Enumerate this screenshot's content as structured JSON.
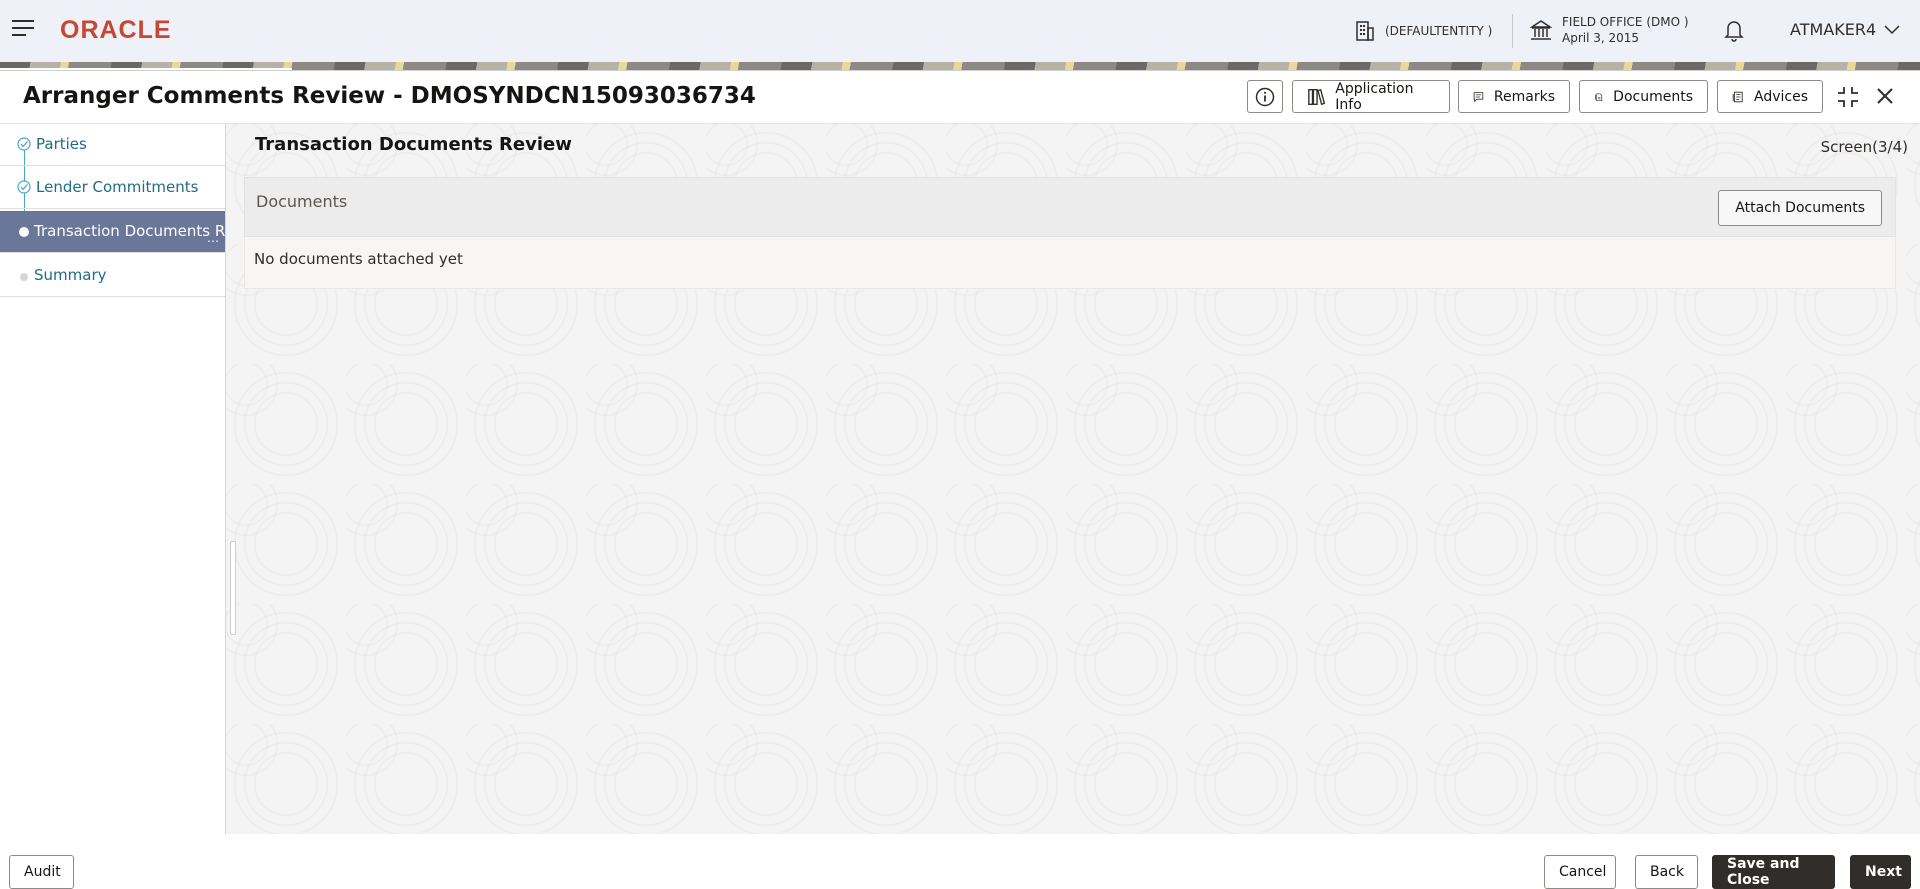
{
  "header": {
    "brand": "ORACLE",
    "entity": "(DEFAULTENTITY )",
    "office_name": "FIELD OFFICE (DMO )",
    "office_date": "April 3, 2015",
    "user": "ATMAKER4"
  },
  "window": {
    "title": "Arranger Comments Review - DMOSYNDCN15093036734",
    "toolbar": {
      "application_info": "Application Info",
      "remarks": "Remarks",
      "documents": "Documents",
      "advices": "Advices"
    }
  },
  "steps": [
    {
      "label": "Parties",
      "state": "done"
    },
    {
      "label": "Lender Commitments",
      "state": "done"
    },
    {
      "label": "Transaction Documents R",
      "state": "active"
    },
    {
      "label": "Summary",
      "state": "pending"
    }
  ],
  "main": {
    "section_title": "Transaction Documents Review",
    "screen_indicator": "Screen(3/4)",
    "documents": {
      "heading": "Documents",
      "attach_label": "Attach Documents",
      "empty_message": "No documents attached yet"
    }
  },
  "footer": {
    "audit": "Audit",
    "cancel": "Cancel",
    "back": "Back",
    "save_close": "Save and Close",
    "next": "Next"
  },
  "colors": {
    "brand": "#c74634",
    "active_step": "#6a7799",
    "link": "#1f6c85",
    "primary_button": "#312d2a"
  }
}
